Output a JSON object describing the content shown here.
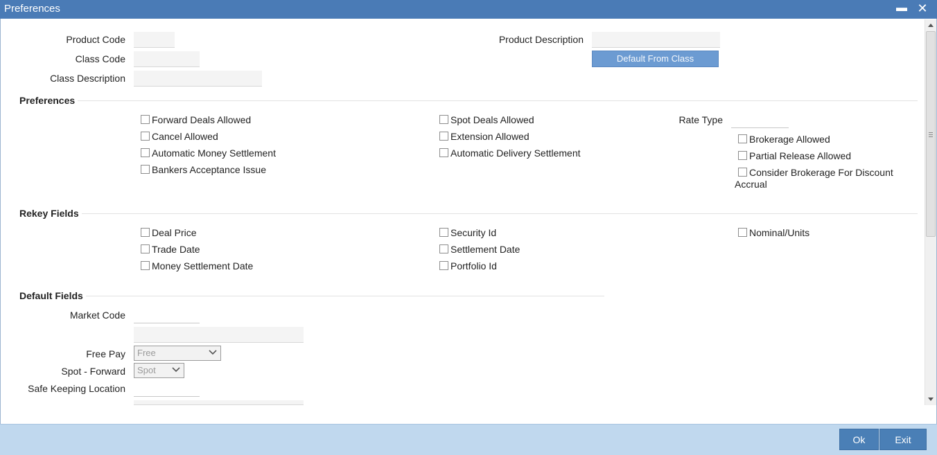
{
  "window": {
    "title": "Preferences",
    "minimize_glyph": "▬",
    "close_glyph": "✕"
  },
  "header": {
    "product_code_label": "Product Code",
    "product_code_value": "",
    "class_code_label": "Class Code",
    "class_code_value": "",
    "class_description_label": "Class Description",
    "class_description_value": "",
    "product_description_label": "Product Description",
    "product_description_value": "",
    "default_from_class_label": "Default From Class"
  },
  "preferences": {
    "heading": "Preferences",
    "rate_type_label": "Rate Type",
    "rate_type_value": "",
    "checkboxes": [
      {
        "label": "Forward Deals Allowed",
        "checked": false
      },
      {
        "label": "Cancel Allowed",
        "checked": false
      },
      {
        "label": "Automatic Money Settlement",
        "checked": false
      },
      {
        "label": "Bankers Acceptance Issue",
        "checked": false
      },
      {
        "label": "Spot Deals Allowed",
        "checked": false
      },
      {
        "label": "Extension Allowed",
        "checked": false
      },
      {
        "label": "Automatic Delivery Settlement",
        "checked": false
      },
      {
        "label": "Brokerage Allowed",
        "checked": false
      },
      {
        "label": "Partial Release Allowed",
        "checked": false
      },
      {
        "label": "Consider Brokerage For Discount",
        "label_line2": "Accrual",
        "checked": false
      }
    ]
  },
  "rekey": {
    "heading": "Rekey Fields",
    "checkboxes": [
      {
        "label": "Deal Price",
        "checked": false
      },
      {
        "label": "Trade Date",
        "checked": false
      },
      {
        "label": "Money Settlement Date",
        "checked": false
      },
      {
        "label": "Security Id",
        "checked": false
      },
      {
        "label": "Settlement Date",
        "checked": false
      },
      {
        "label": "Portfolio Id",
        "checked": false
      },
      {
        "label": "Nominal/Units",
        "checked": false
      }
    ]
  },
  "defaults": {
    "heading": "Default Fields",
    "market_code_label": "Market Code",
    "market_code_value": "",
    "market_code_desc": "",
    "free_pay_label": "Free Pay",
    "free_pay_value": "Free",
    "spot_forward_label": "Spot - Forward",
    "spot_forward_value": "Spot",
    "safe_keeping_label": "Safe Keeping Location",
    "safe_keeping_value": "",
    "safe_keeping_desc": ""
  },
  "footer": {
    "ok_label": "Ok",
    "exit_label": "Exit"
  }
}
